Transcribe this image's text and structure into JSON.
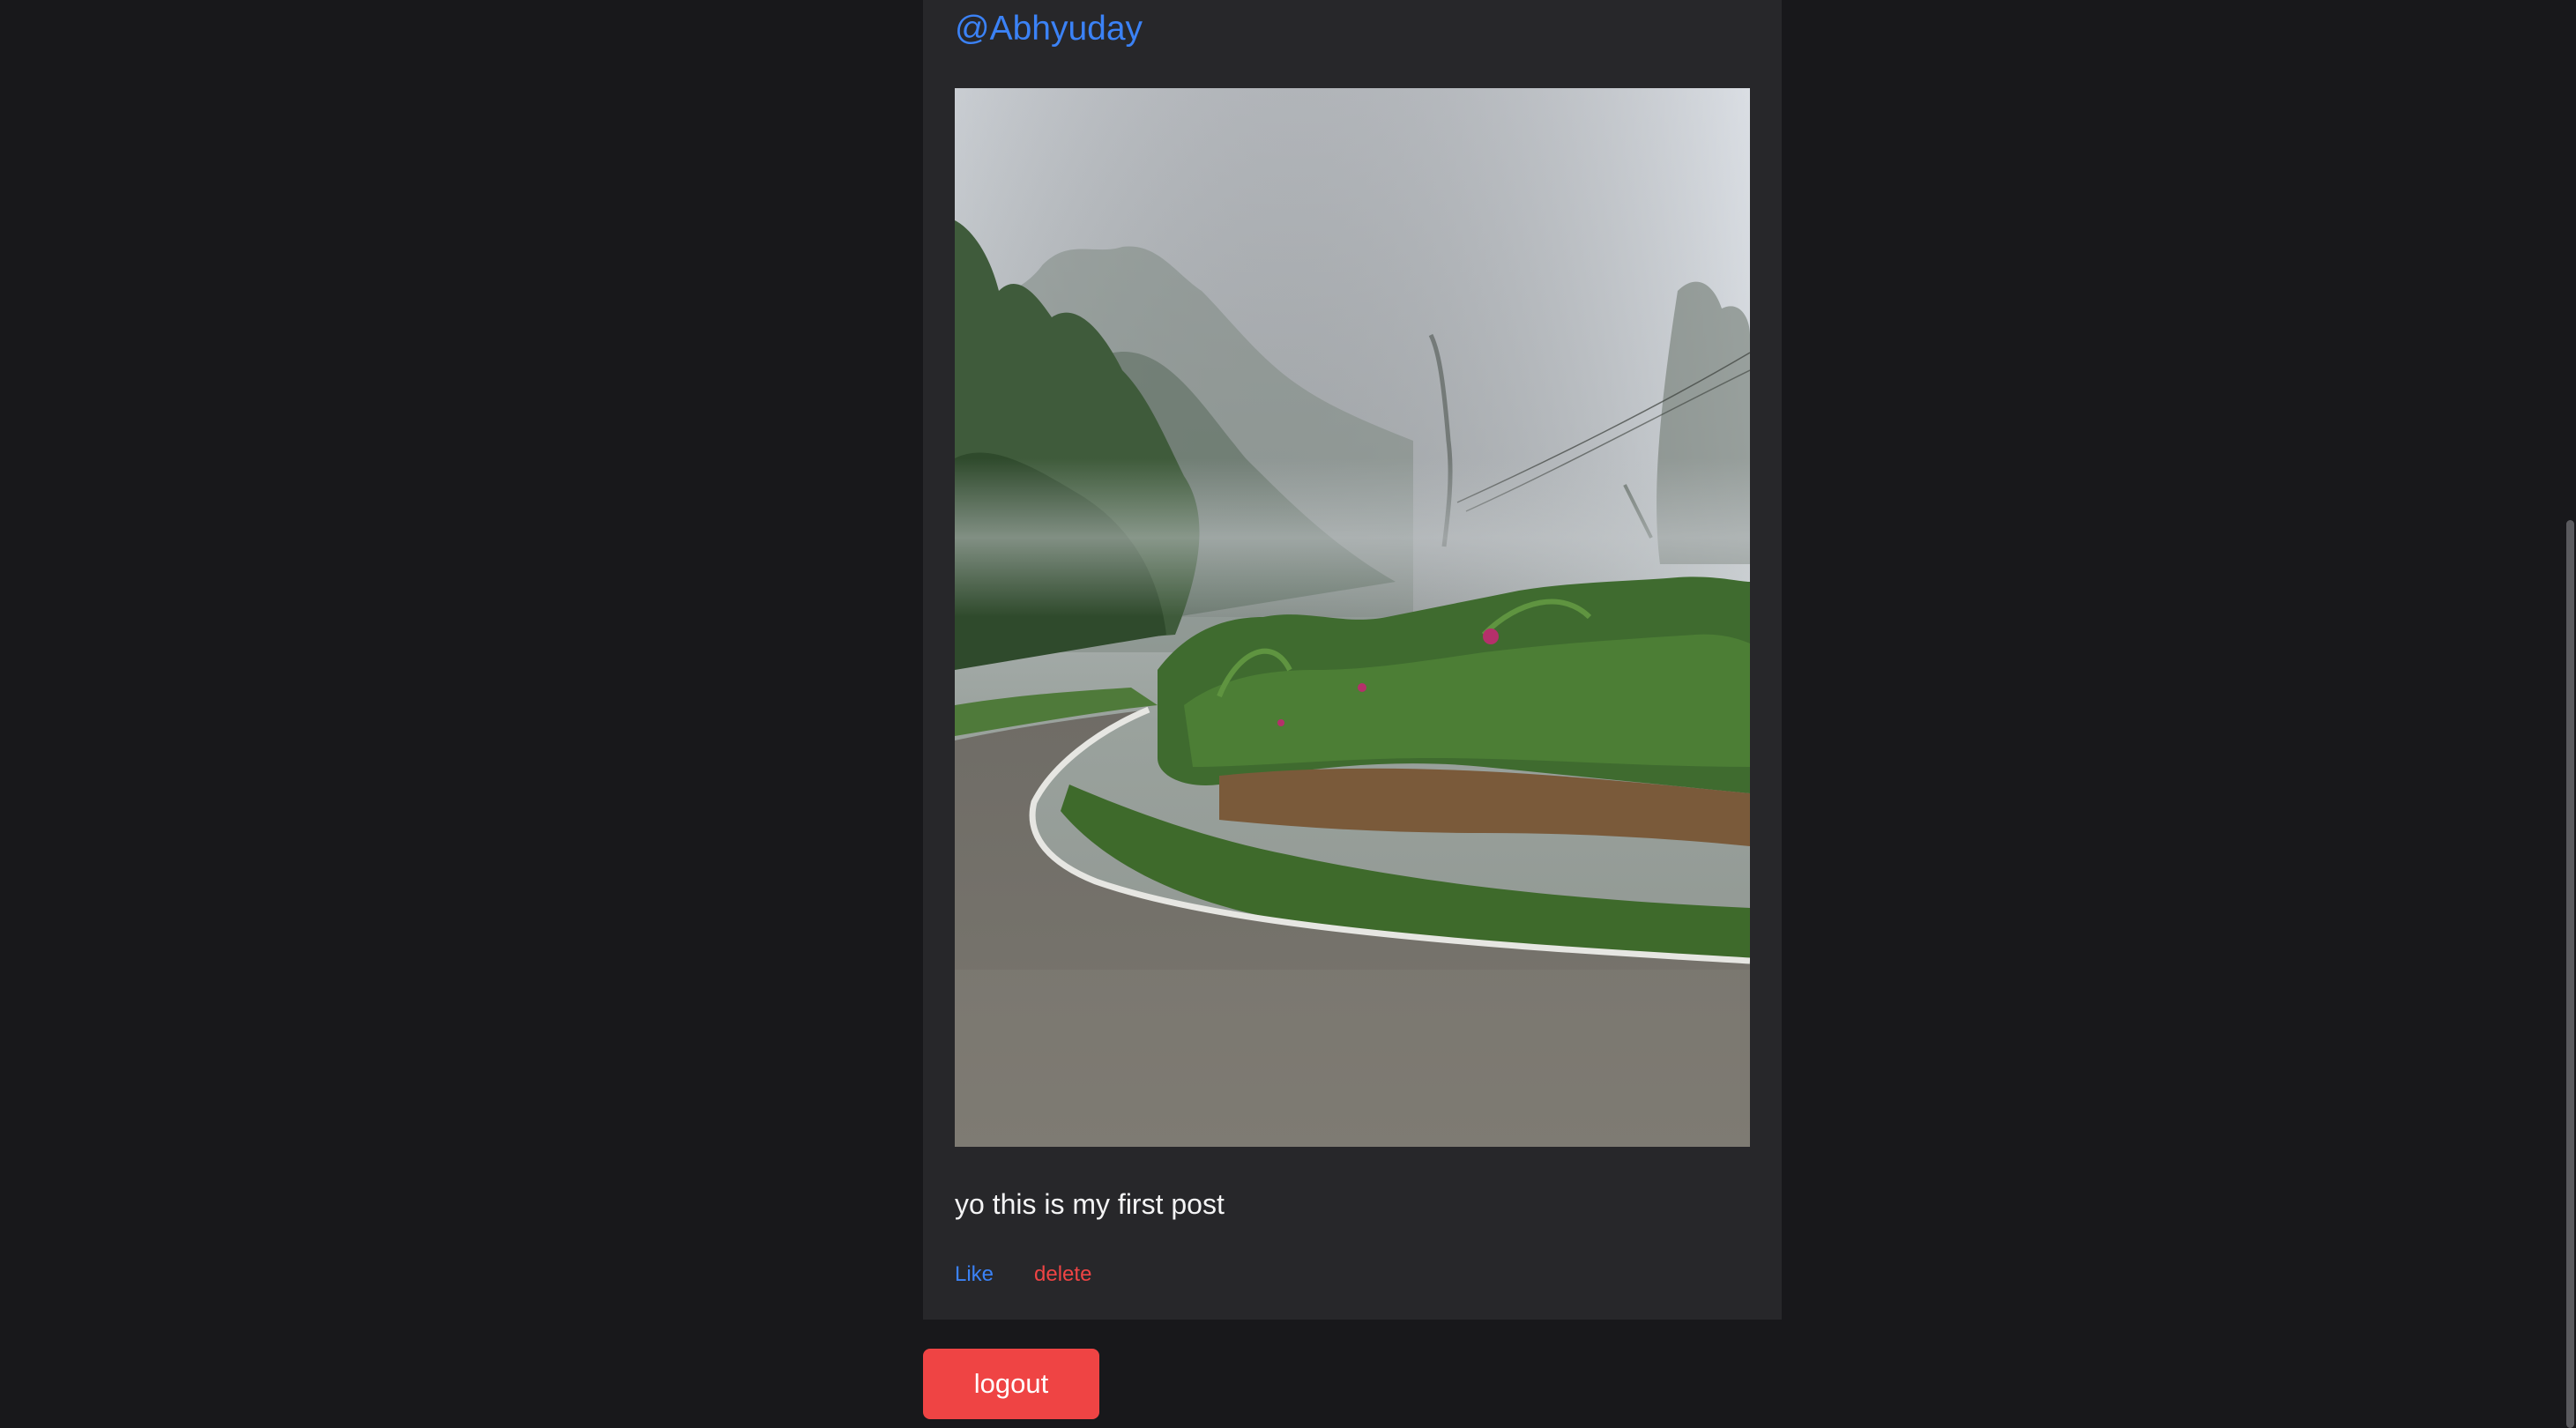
{
  "post": {
    "author": "@Abhyuday",
    "image_alt": "",
    "caption": "yo this is my first post",
    "like_label": "Like",
    "delete_label": "delete"
  },
  "logout_label": "logout",
  "colors": {
    "page_background": "#18181b",
    "card_background": "#27272a",
    "link_blue": "#3b82f6",
    "danger_red": "#ef4444",
    "text_primary": "#f4f4f5"
  }
}
